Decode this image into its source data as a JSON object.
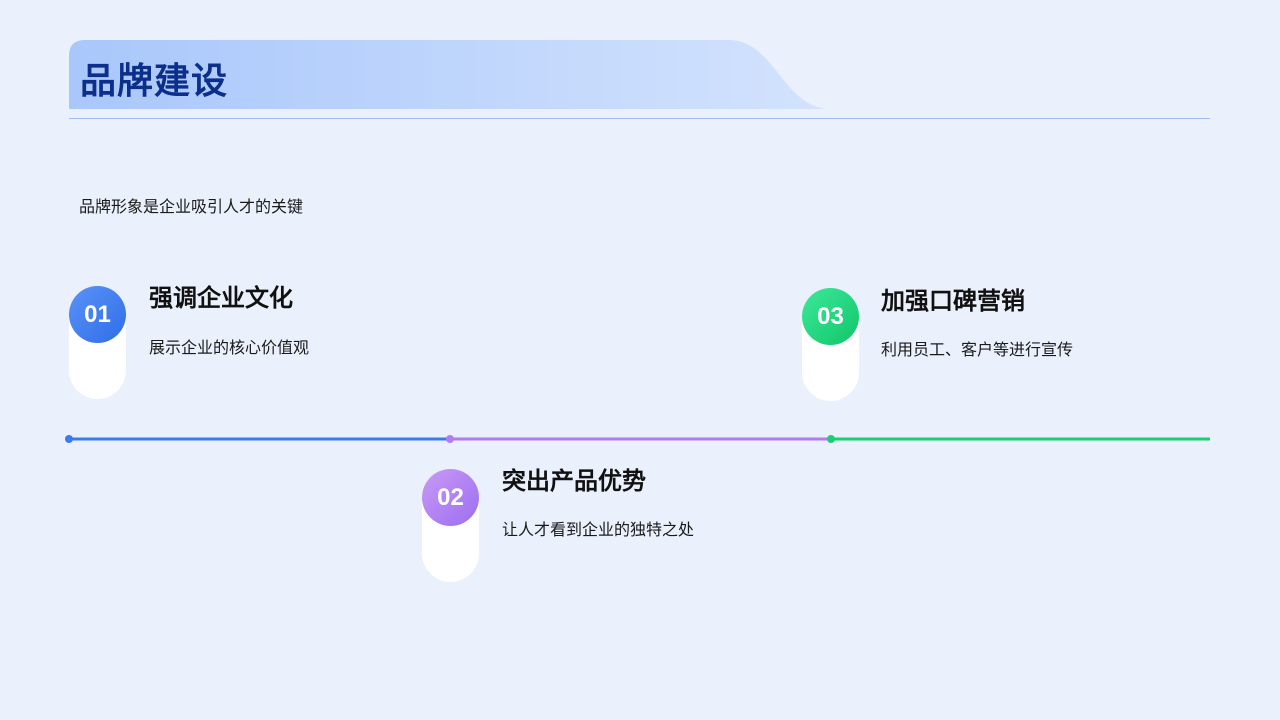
{
  "page": {
    "title": "品牌建设",
    "subtitle": "品牌形象是企业吸引人才的关键"
  },
  "items": [
    {
      "number": "01",
      "title": "强调企业文化",
      "description": "展示企业的核心价值观",
      "color": "#3b7bef"
    },
    {
      "number": "02",
      "title": "突出产品优势",
      "description": "让人才看到企业的独特之处",
      "color": "#b07cf2"
    },
    {
      "number": "03",
      "title": "加强口碑营销",
      "description": "利用员工、客户等进行宣传",
      "color": "#18cf72"
    }
  ],
  "colors": {
    "background": "#eaf1fd",
    "title_text": "#0b2f8a",
    "banner_start": "#a9c7fb",
    "banner_end": "#d3e3fd",
    "rule": "#9dbcf2"
  }
}
